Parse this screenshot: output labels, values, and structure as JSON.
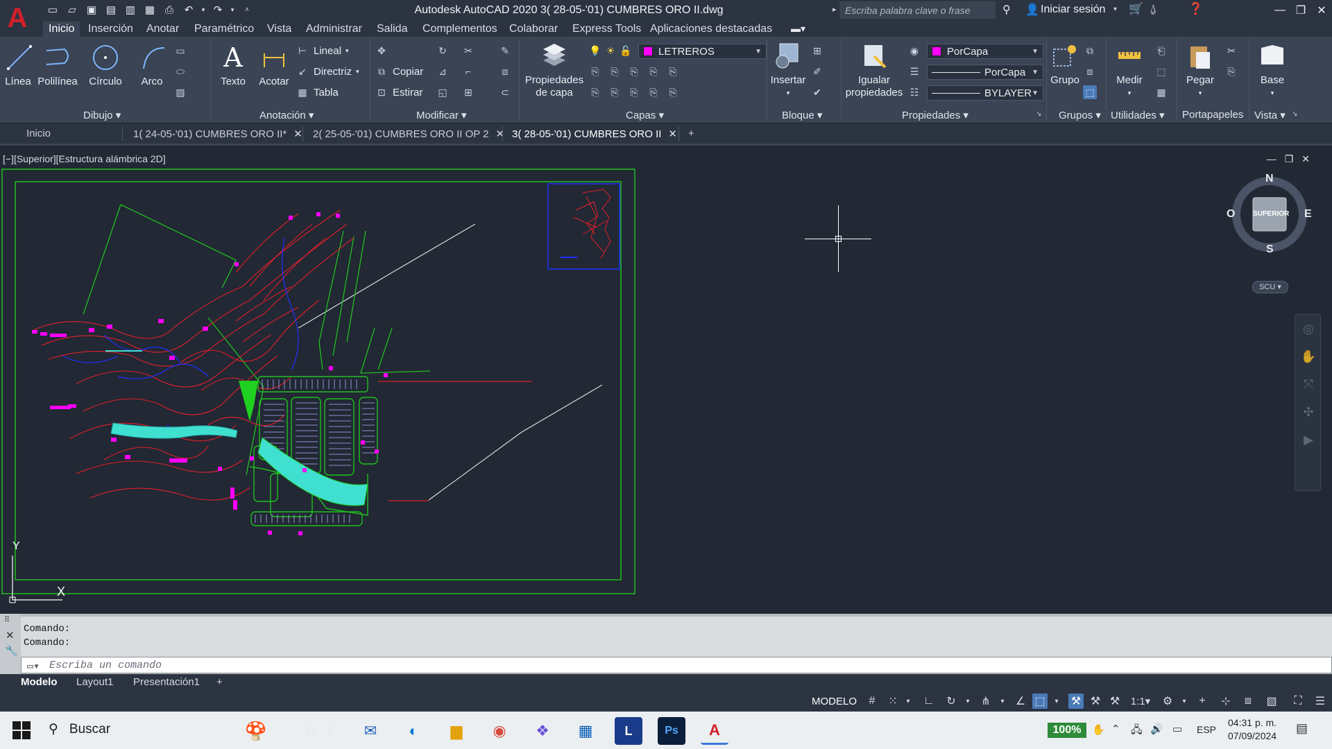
{
  "app": {
    "title": "Autodesk AutoCAD 2020    3( 28-05-'01) CUMBRES ORO II.dwg",
    "search_placeholder": "Escriba palabra clave o frase",
    "signin": "Iniciar sesión",
    "logo": "A"
  },
  "ribbon_tabs": [
    "Inicio",
    "Inserción",
    "Anotar",
    "Paramétrico",
    "Vista",
    "Administrar",
    "Salida",
    "Complementos",
    "Colaborar",
    "Express Tools",
    "Aplicaciones destacadas"
  ],
  "ribbon": {
    "dibujo": {
      "title": "Dibujo",
      "linea": "Línea",
      "polilinea": "Polilínea",
      "circulo": "Círculo",
      "arco": "Arco"
    },
    "anotacion": {
      "title": "Anotación",
      "texto": "Texto",
      "acotar": "Acotar",
      "lineal": "Lineal",
      "directriz": "Directriz",
      "tabla": "Tabla"
    },
    "modificar": {
      "title": "Modificar",
      "copiar": "Copiar",
      "estirar": "Estirar"
    },
    "capas": {
      "title": "Capas",
      "propiedades_l1": "Propiedades",
      "propiedades_l2": "de capa",
      "layer_current": "LETREROS",
      "layer_color": "#ff00ff"
    },
    "bloque": {
      "title": "Bloque",
      "insertar": "Insertar"
    },
    "propiedades": {
      "title": "Propiedades",
      "igualar_l1": "Igualar",
      "igualar_l2": "propiedades",
      "color": "PorCapa",
      "linetype": "PorCapa",
      "lineweight": "BYLAYER"
    },
    "grupos": {
      "title": "Grupos",
      "grupo": "Grupo"
    },
    "utilidades": {
      "title": "Utilidades",
      "medir": "Medir"
    },
    "portapapeles": {
      "title": "Portapapeles",
      "pegar": "Pegar"
    },
    "vista": {
      "title": "Vista",
      "base": "Base"
    }
  },
  "file_tabs": [
    "Inicio",
    "1( 24-05-'01) CUMBRES ORO II*",
    "2( 25-05-'01) CUMBRES ORO II OP 2",
    "3( 28-05-'01) CUMBRES ORO II"
  ],
  "viewport": {
    "label": "[−][Superior][Estructura alámbrica 2D]",
    "viewcube": {
      "n": "N",
      "s": "S",
      "e": "E",
      "o": "O",
      "face": "SUPERIOR"
    },
    "scu": "SCU",
    "ucs_x": "X",
    "ucs_y": "Y"
  },
  "command": {
    "history": [
      "Comando:",
      "Comando:"
    ],
    "placeholder": "Escriba un comando"
  },
  "layout_tabs": [
    "Modelo",
    "Layout1",
    "Presentación1"
  ],
  "status": {
    "mode": "MODELO",
    "scale": "1:1"
  },
  "taskbar": {
    "search": "Buscar",
    "zoom": "100%",
    "lang": "ESP",
    "time": "04:31 p. m.",
    "date": "07/09/2024"
  },
  "colors": {
    "accent": "#4a7ab8",
    "contours": "#e0202a",
    "lots": "#22cc22",
    "water": "#40e0d0",
    "blocks": "#ff00ff",
    "paths": "#2030ff"
  }
}
